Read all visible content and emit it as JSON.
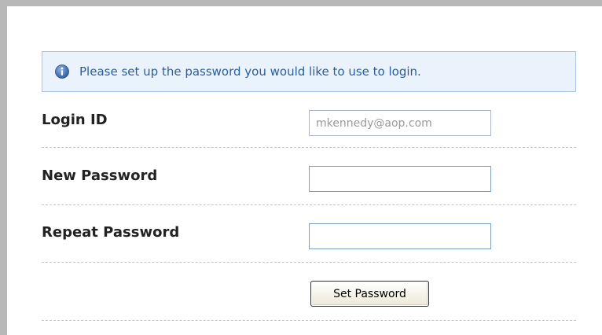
{
  "info": {
    "icon": "info-circle-icon",
    "message": "Please set up the password you would like to use to login.",
    "color": "#2a5e9e"
  },
  "form": {
    "login_id": {
      "label": "Login ID",
      "value": "mkennedy@aop.com"
    },
    "new_password": {
      "label": "New Password",
      "value": ""
    },
    "repeat_password": {
      "label": "Repeat Password",
      "value": ""
    },
    "submit_label": "Set Password"
  }
}
